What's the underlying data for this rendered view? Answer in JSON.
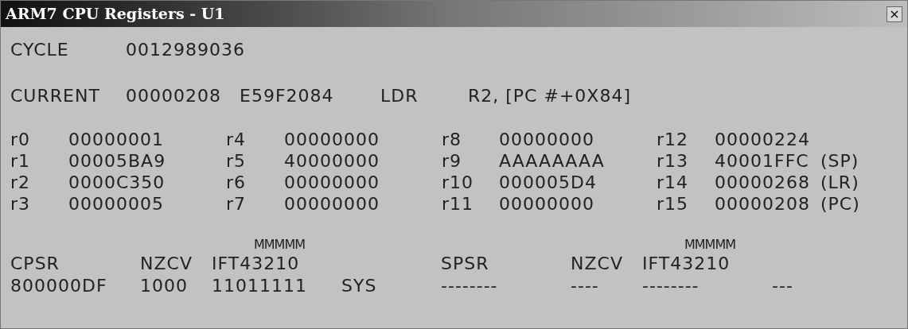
{
  "window": {
    "title": "ARM7 CPU Registers - U1",
    "close_glyph": "×"
  },
  "cycle": {
    "label": "CYCLE",
    "value": "0012989036"
  },
  "current": {
    "label": "CURRENT",
    "address": "00000208",
    "opcode": "E59F2084",
    "mnemonic": "LDR",
    "operands": "R2, [PC #+0X84]"
  },
  "register_rows": [
    [
      {
        "name": "r0",
        "value": "00000001"
      },
      {
        "name": "r4",
        "value": "00000000"
      },
      {
        "name": "r8",
        "value": "00000000"
      },
      {
        "name": "r12",
        "value": "00000224"
      }
    ],
    [
      {
        "name": "r1",
        "value": "00005BA9"
      },
      {
        "name": "r5",
        "value": "40000000"
      },
      {
        "name": "r9",
        "value": "AAAAAAAA"
      },
      {
        "name": "r13",
        "value": "40001FFC",
        "alias": "(SP)"
      }
    ],
    [
      {
        "name": "r2",
        "value": "0000C350"
      },
      {
        "name": "r6",
        "value": "00000000"
      },
      {
        "name": "r10",
        "value": "000005D4"
      },
      {
        "name": "r14",
        "value": "00000268",
        "alias": "(LR)"
      }
    ],
    [
      {
        "name": "r3",
        "value": "00000005"
      },
      {
        "name": "r7",
        "value": "00000000"
      },
      {
        "name": "r11",
        "value": "00000000"
      },
      {
        "name": "r15",
        "value": "00000208",
        "alias": "(PC)"
      }
    ]
  ],
  "status_registers": [
    {
      "label": "CPSR",
      "flags_heading": "NZCV",
      "bits_heading_top": "MMMMM",
      "bits_heading": "IFT43210",
      "value": "800000DF",
      "flags": "1000",
      "bits": "11011111",
      "mode": "SYS"
    },
    {
      "label": "SPSR",
      "flags_heading": "NZCV",
      "bits_heading_top": "MMMMM",
      "bits_heading": "IFT43210",
      "value": "--------",
      "flags": "----",
      "bits": "--------",
      "mode": "---"
    }
  ]
}
